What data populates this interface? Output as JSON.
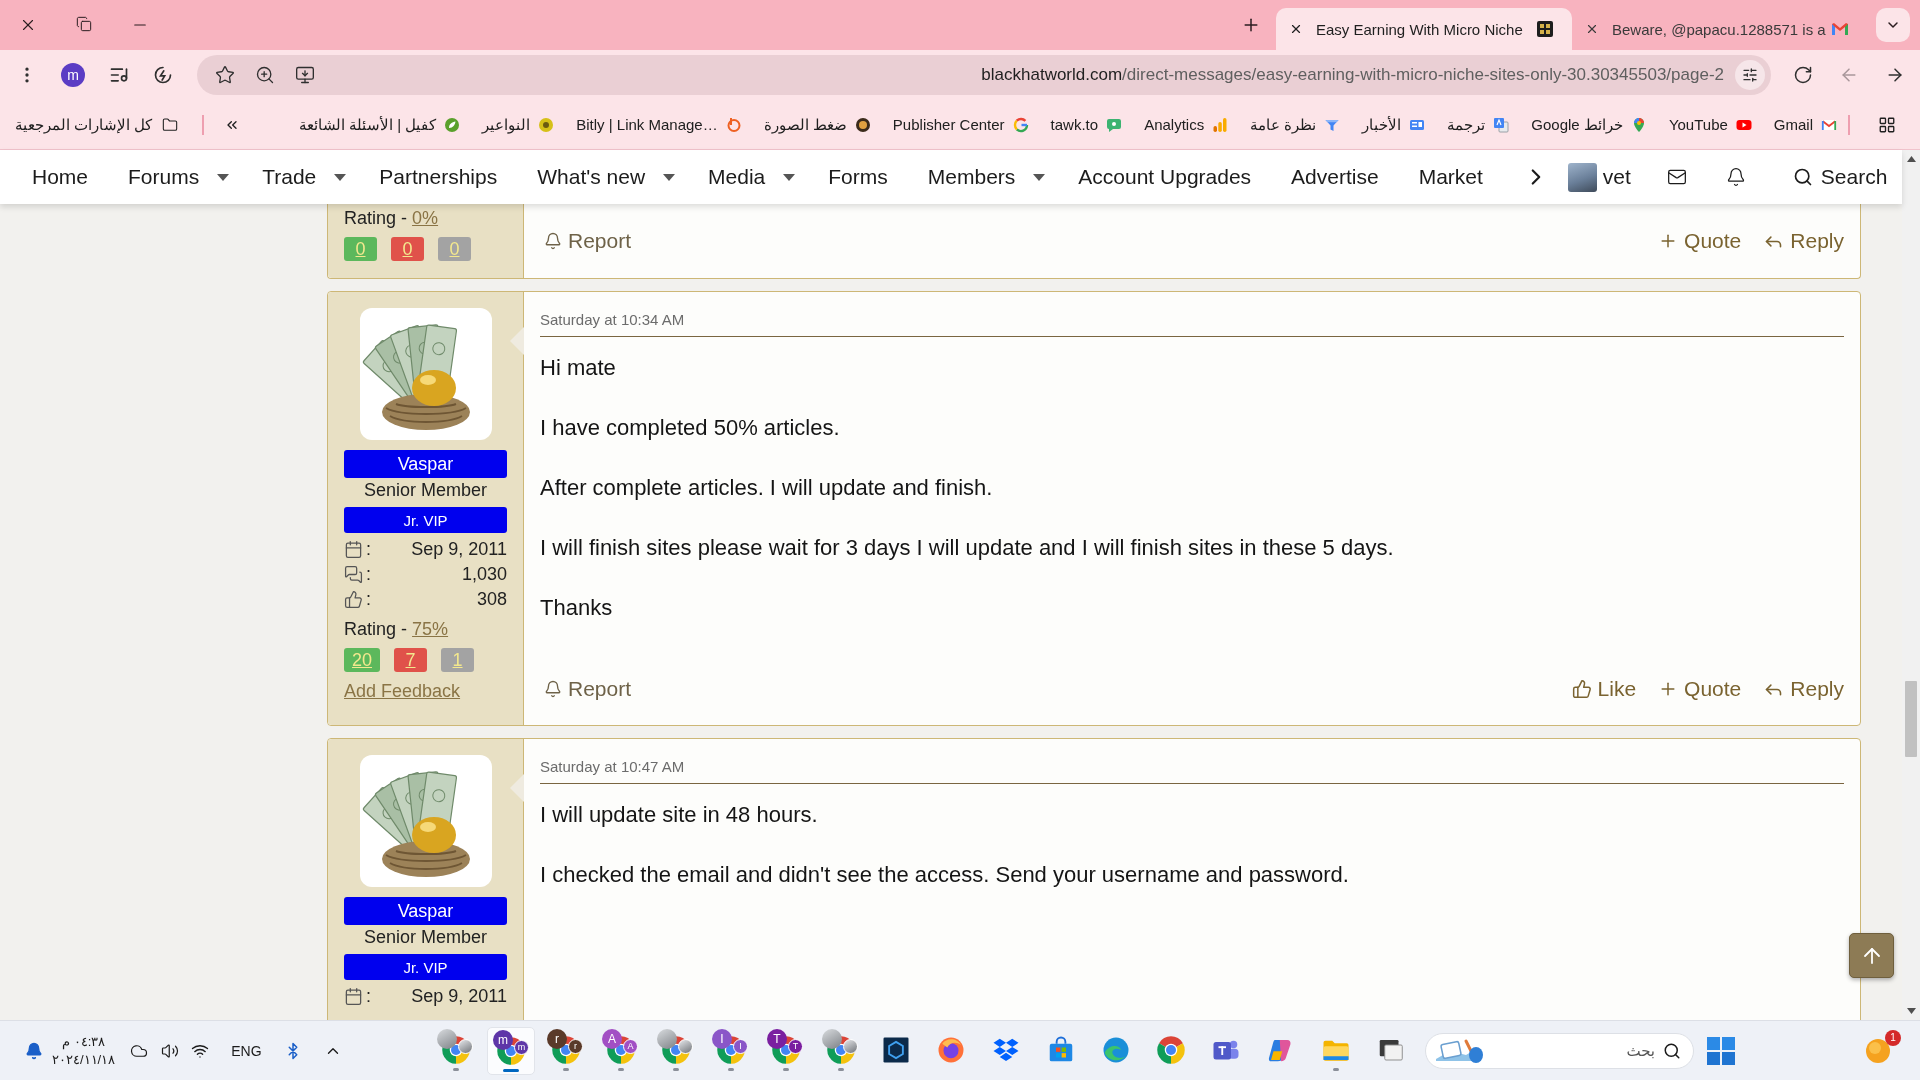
{
  "window": {
    "tabs": [
      {
        "title": "Easy Earning With Micro Niche",
        "selected": true,
        "kind": "forum"
      },
      {
        "title": "Beware, @papacu.1288571 is a",
        "selected": false,
        "kind": "mail"
      }
    ],
    "profile_initial": "m",
    "url": {
      "host": "blackhatworld.com",
      "path": "/direct-messages/easy-earning-with-micro-niche-sites-only-30.30345503/page-2"
    },
    "nav_buttons": [
      {
        "kind": "reload",
        "disabled": false
      },
      {
        "kind": "left",
        "disabled": true
      },
      {
        "kind": "right",
        "disabled": false
      }
    ]
  },
  "bookmarks": {
    "all_label": "كل الإشارات المرجعية",
    "items": [
      {
        "label": "كفيل | الأسئلة الشائعة",
        "kind": "faq"
      },
      {
        "label": "النواعير",
        "kind": "wheel"
      },
      {
        "label": "Bitly | Link Manage…",
        "kind": "bitly"
      },
      {
        "label": "ضغط الصورة",
        "kind": "compress"
      },
      {
        "label": "Publisher Center",
        "kind": "google"
      },
      {
        "label": "tawk.to",
        "kind": "tawk"
      },
      {
        "label": "Analytics",
        "kind": "analytics"
      },
      {
        "label": "نظرة عامة",
        "kind": "overview"
      },
      {
        "label": "الأخبار",
        "kind": "news"
      },
      {
        "label": "ترجمة",
        "kind": "translate"
      },
      {
        "label": "خرائط Google",
        "kind": "maps"
      },
      {
        "label": "YouTube",
        "kind": "youtube"
      },
      {
        "label": "Gmail",
        "kind": "gmail"
      }
    ]
  },
  "nav": {
    "items": [
      {
        "label": "Home",
        "dropdown": false
      },
      {
        "label": "Forums",
        "dropdown": true
      },
      {
        "label": "Trade",
        "dropdown": true
      },
      {
        "label": "Partnerships",
        "dropdown": false
      },
      {
        "label": "What's new",
        "dropdown": true
      },
      {
        "label": "Media",
        "dropdown": true
      },
      {
        "label": "Forms",
        "dropdown": false
      },
      {
        "label": "Members",
        "dropdown": true
      },
      {
        "label": "Account Upgrades",
        "dropdown": false
      },
      {
        "label": "Advertise",
        "dropdown": false
      },
      {
        "label": "Market",
        "dropdown": false
      }
    ],
    "user": "vet",
    "search": "Search"
  },
  "posts": [
    {
      "rating_label": "Rating -",
      "rating": "0%",
      "feedback": [
        {
          "kind": "positive",
          "count": "0"
        },
        {
          "kind": "negative",
          "count": "0"
        },
        {
          "kind": "neutral",
          "count": "0"
        }
      ],
      "actions": [
        {
          "kind": "report",
          "label": "Report"
        },
        {
          "kind": "quote",
          "label": "Quote"
        },
        {
          "kind": "reply",
          "label": "Reply"
        }
      ]
    },
    {
      "author": {
        "name": "Vaspar",
        "title": "Senior Member",
        "banner": "Jr. VIP",
        "stats": [
          {
            "kind": "joined",
            "label": ":",
            "value": "Sep 9, 2011"
          },
          {
            "kind": "messages",
            "label": ":",
            "value": "1,030"
          },
          {
            "kind": "reactions",
            "label": ":",
            "value": "308"
          }
        ]
      },
      "rating_label": "Rating -",
      "rating": "75%",
      "feedback": [
        {
          "kind": "positive",
          "count": "20"
        },
        {
          "kind": "negative",
          "count": "7"
        },
        {
          "kind": "neutral",
          "count": "1"
        }
      ],
      "add_feedback": "Add Feedback",
      "time": "Saturday at 10:34 AM",
      "paragraphs": [
        "Hi mate",
        "I have completed 50% articles.",
        "After complete articles. I will update and finish.",
        "I will finish sites please wait for 3 days I will update and I will finish sites in these 5 days.",
        "Thanks"
      ],
      "actions": [
        {
          "kind": "report",
          "label": "Report"
        },
        {
          "kind": "like",
          "label": "Like"
        },
        {
          "kind": "quote",
          "label": "Quote"
        },
        {
          "kind": "reply",
          "label": "Reply"
        }
      ]
    },
    {
      "author": {
        "name": "Vaspar",
        "title": "Senior Member",
        "banner": "Jr. VIP",
        "stats": [
          {
            "kind": "joined",
            "label": ":",
            "value": "Sep 9, 2011"
          }
        ]
      },
      "time": "Saturday at 10:47 AM",
      "paragraphs": [
        "I will update site in 48 hours.",
        "I checked the email and didn't see the access. Send your username and password."
      ]
    }
  ],
  "taskbar": {
    "clock_time": "٠٤:٣٨ م",
    "clock_date": "٢٠٢٤/١١/١٨",
    "language": "ENG",
    "apps": [
      {
        "kind": "chrome-photo",
        "running": true,
        "selected": false
      },
      {
        "kind": "chrome-letter",
        "letters": [
          "m",
          "m"
        ],
        "color": "#5e36a8",
        "running": true,
        "selected": true
      },
      {
        "kind": "chrome-letter",
        "letters": [
          "r",
          "r"
        ],
        "color": "#5a3a2a",
        "running": true,
        "selected": false
      },
      {
        "kind": "chrome-letter",
        "letters": [
          "A",
          "A"
        ],
        "color": "#a24fc4",
        "running": true,
        "selected": false
      },
      {
        "kind": "chrome-photo",
        "running": true,
        "selected": false
      },
      {
        "kind": "chrome-letter",
        "letters": [
          "I",
          "I"
        ],
        "color": "#8a56c8",
        "running": true,
        "selected": false
      },
      {
        "kind": "chrome-letter",
        "letters": [
          "T",
          "T"
        ],
        "color": "#7a1fa0",
        "running": true,
        "selected": false
      },
      {
        "kind": "chrome-photo",
        "running": true,
        "selected": false
      },
      {
        "kind": "vault",
        "running": false,
        "selected": false
      },
      {
        "kind": "firefox",
        "running": false,
        "selected": false
      },
      {
        "kind": "dropbox",
        "running": false,
        "selected": false
      },
      {
        "kind": "store",
        "running": false,
        "selected": false
      },
      {
        "kind": "edge",
        "running": false,
        "selected": false
      },
      {
        "kind": "chrome",
        "running": false,
        "selected": false
      },
      {
        "kind": "teams",
        "running": false,
        "selected": false
      },
      {
        "kind": "copilot",
        "running": false,
        "selected": false
      },
      {
        "kind": "explorer",
        "running": true,
        "selected": false
      },
      {
        "kind": "window",
        "running": false,
        "selected": false
      }
    ],
    "search_placeholder": "بحث",
    "notification_count": "1"
  }
}
